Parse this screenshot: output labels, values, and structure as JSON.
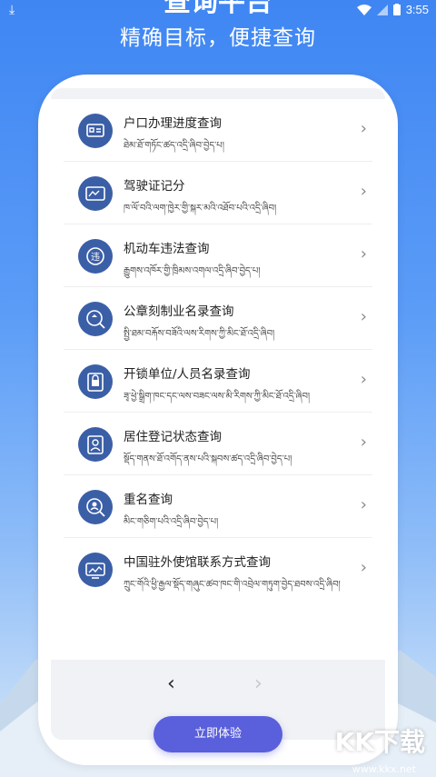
{
  "status_bar": {
    "time": "3:55"
  },
  "header": {
    "title": "查询平台",
    "subtitle": "精确目标，便捷查询"
  },
  "list": [
    {
      "icon": "id-card-icon",
      "title": "户口办理进度查询",
      "subtitle": "ཐེམ་ཐོ་གཏོང་ཚད་འདྲི་ཞིབ་བྱེད་པ།"
    },
    {
      "icon": "car-license-icon",
      "title": "驾驶证记分",
      "subtitle": "ཁ་ལོ་བའི་ལག་ཁྱེར་གྱི་སྐར་མའི་འཐོབ་པའི་འདྲི་ཞིབ།"
    },
    {
      "icon": "violation-icon",
      "title": "机动车违法查询",
      "subtitle": "རྒྱུགས་འཁོར་གྱི་ཁྲིམས་འགལ་འདྲི་ཞིབ་བྱེད་པ།"
    },
    {
      "icon": "seal-search-icon",
      "title": "公章刻制业名录查询",
      "subtitle": "སྤྱི་ཐམ་བརྐོས་བཟོའི་ལས་རིགས་ཀྱི་མིང་ཐོ་འདྲི་ཞིབ།"
    },
    {
      "icon": "lock-icon",
      "title": "开锁单位/人员名录查询",
      "subtitle": "ཟྭ་ཕྱེ་སྒྲིག་ཁང་དང་ལས་བཟང་ལས་མི་རིགས་ཀྱི་མིང་ཐོ་འདྲི་ཞིབ།"
    },
    {
      "icon": "residence-icon",
      "title": "居住登记状态查询",
      "subtitle": "སྡོད་གནས་ཐོ་འགོད་ནས་པའི་སྐབས་ཚད་འདྲི་ཞིབ་བྱེད་པ།"
    },
    {
      "icon": "name-search-icon",
      "title": "重名查询",
      "subtitle": "མིང་གཅིག་པའི་འདྲི་ཞིབ་བྱེད་པ།"
    },
    {
      "icon": "embassy-icon",
      "title": "中国驻外使馆联系方式查询",
      "subtitle": "ཀྲུང་གོའི་ཕྱི་རྒྱལ་སྡོད་གཞུང་ཚབ་ཁང་གི་འབྲེལ་གཏུག་བྱེད་ཐབས་འདྲི་ཞིབ།"
    }
  ],
  "pager": {
    "prev": "‹",
    "next": "›"
  },
  "cta": {
    "label": "立即体验"
  },
  "watermark": {
    "text": "KK下载",
    "url": "www.kkx.net"
  },
  "colors": {
    "accent": "#5a5fdb",
    "icon_bg": "#3b5fa7",
    "bg_top": "#3f86f3"
  }
}
